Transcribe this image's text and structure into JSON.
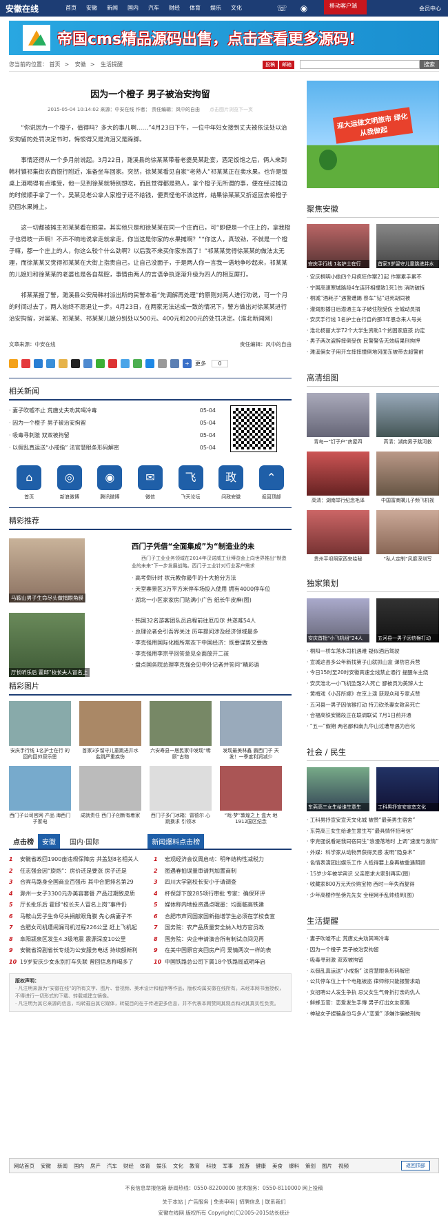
{
  "site": {
    "logo": "安徽在线",
    "member": "会员中心",
    "mobile": "移动客户端"
  },
  "nav": [
    "首页",
    "安徽",
    "新闻",
    "国内",
    "汽车",
    "财经",
    "体育",
    "娱乐",
    "文化"
  ],
  "banner": {
    "text": "帝国cms精品源码出售，点击查看更多源码!"
  },
  "breadcrumb": {
    "prefix": "您当前的位置：",
    "items": [
      "首页",
      "安徽",
      "生活提醒"
    ]
  },
  "tools": {
    "tag1": "投稿",
    "tag2": "邮箱",
    "search_btn": "搜索"
  },
  "article": {
    "title": "因为一个橙子 男子被治安拘留",
    "meta": "2015-05-04 10:14:02 来源：中安在线 作者：  责任编辑：风中的自由",
    "meta_gray": "点击图片浏览下一页",
    "paragraphs": [
      "“你说因为一个橙子，值得吗？多大的事儿啊……”4月23日下午，一位中年妇女接到丈夫被依法处以治安拘留的处罚决定书时，悔恨得又是流泪又是跺脚。",
      "事情还得从一个多月前说起。3月22日，濉溪县的徐某某带着老婆吴某赴宴，酒足饭饱之后，俩人来到韩村镇祁集街农商银行附近，准备坐车回家。突然，徐某某看见自家“老熟人”祁某某正在卖水果。也许是饭桌上酒喝得有点难受，他一见到徐某就特别想吃，而且觉得都是熟人，拿个橙子无所谓的事，便在经过摊边的时候顺手拿了一个。吴某见老公拿人家橙子还不给钱，便责怪他不该这样，结果徐某某又折返回去将橙子扔回水果摊上。",
      "这一切都被摊主祁某某看在眼里。其实他只是和徐某某在同一个庄而已，可“即便是一个庄上的，拿我橙子也得吱一声啊！不声不响地说拿走就拿走，你当这是你家的水果摊啊？”“你这人，真较劲，不就是一个橙子嘛，都一个庄上的人，你这么较个什么劲啊？以后我不来买你家东西了！”祁某某觉得徐某某的做法太无理，而徐某某又觉得祁某某在大街上指责自己，让自己没面子，于是两人你一言我一语地争吵起来，祁某某的儿媳妇和徐某某的老婆也是各自帮腔，事情由两人的言语争执逐渐升级为四人的相互厮打。",
      "祁某某报了警，濉溪县公安局韩村派出所的民警本着“先调解再处理”的原则对两人进行劝说，可一个月的时间过去了，两人始终不愿退让一步。4月23日，在两家无法达成一致的情况下，警方做出对徐某某进行治安拘留，对吴某、祁某某、祁某某儿媳分别处以500元、400元和200元的处罚决定。(淮北新闻网)"
    ],
    "source_label": "文章来源：中安在线",
    "editor_label": "责任编辑：风中的自由",
    "share_more": "更多",
    "share_count": "0"
  },
  "related": {
    "title": "相关新闻",
    "items": [
      {
        "t": "妻子吹嘘不止 荒唐丈夫劝其喝冷毒",
        "d": "05-04"
      },
      {
        "t": "因为一个橙子 男子被治安拘留",
        "d": "05-04"
      },
      {
        "t": "吸毒寻刺激 双双被拘留",
        "d": "05-04"
      },
      {
        "t": "以假乱真运送“小戒指” 法官慧眼条形码解密",
        "d": "05-04"
      }
    ]
  },
  "apps": [
    "首页",
    "新浪微博",
    "腾讯微博",
    "微信",
    "飞天论坛",
    "问政安徽",
    "返回顶部"
  ],
  "picks": {
    "title": "精彩推荐",
    "cap1": "马鞍山男子生命尽头做捐眼角膜",
    "cap2": "厅长听乐后 霍邱“校长夫人冒名上",
    "head": "西门子凭借“全面集成”为“制造业的未",
    "sub": "西门子工业业务领域在2014年汉诺威工业博览会上向世界推出“制造业的未来”下一步发展战略。西门子工业针对行业客户需求",
    "list1": [
      "高考倒计时 状元教你最牛的十大抢分方法",
      "天堂寨景区3万平方米停车场投入使用 拥有4000停车位",
      "湖北一小区家家房门贴满小广告 纸长牛皮癣(图)"
    ],
    "list2": [
      "韩国32名游客团队员启程前往厄瓜尔 共遂难54人",
      "总理论者会引吾界关注 历年提问涉及经济领域最多",
      "李克强用国际化概所常态下中国经济：既要谋势又要做",
      "李克强用李宗平回答意见全面放开二孩",
      "盘点国务院总理李克强会见中外记者并答问“精彩语"
    ]
  },
  "gallery": {
    "title": "精彩图片",
    "items": [
      "安庆手行线 1名护士在行 的回的回帅原乐思",
      "首家3岁留守儿童跳进井水 盐跳严重疾伤",
      "六安寿县一居民家中发现“稀顾”古物",
      "发现最美林鑫 霸西门子 天发！一季度利润减少",
      "西门子公司官网 产品 海西门子家电",
      "成就责任 西门子创新有着家",
      "西门子多门冰箱：雷德尔 心跳换求 引领冰",
      "“戏·梦”敦煌之上 盒大 地1912国区纪念"
    ]
  },
  "rank": {
    "tab_title": "点击榜",
    "tab1": "安徽",
    "tab2": "国内·国际",
    "tab3": "新闻爆料点击榜",
    "left": [
      "安徽省政回1900亩违规保障房 共盖划8名相关人",
      "任志强会因“旋炮”：房价还是要涨 房子还是",
      "合宾马路身全国商业百强市 其中合肥排名第29",
      "滁州一女子3300元办美容套餐 产品过期致皮质",
      "厅长批乐后 霍邱“校长夫人冒名上岗”事件仍",
      "马鞍山男子生命尽头捐献眼角膜 先心病妻子不",
      "合肥女司机遭闹漏司机过程226公里 赶上飞机起",
      "阜阳颍泉区发生4.3级地震 震源深度10公里",
      "安徽省滑副省长专线为公安服务电话 持续额新利",
      "19岁安庆少女永别打车失联 曾回信息称喝多了"
    ],
    "right": [
      "宏观经济会议周启动：明年结构性减税力",
      "图遇春拍误量审请判加置商制",
      "四川大学副校长安小于请调查",
      "杯保部下放285项行审批 专家：确保环评",
      "媒体称内地投资遇点哦墨：均面临高铁建",
      "合肥市声同国家国新指增学生必须在学校食宣",
      "国务院：农产品质量安全纳入地方官员政",
      "国务院：央企申请演合所有制试点间见再",
      "在美中国原官夹回房产问 爱情两次一样的表",
      "中国铁路总公司下属18个铁路局或明年启"
    ]
  },
  "disclaimer": {
    "h": "版权声明：",
    "lines": [
      "· 凡注明来源为“安徽在线”的所有文字、图片、音视频、美术设计和程序等作品，版权均属安徽在线所有。未经本网书面授权，不得进行一切形式的下载、转载或建立镜像。",
      "· 凡注明为其它来源的信息，均转载自其它媒体，转载目的在于传递更多信息，并不代表本网赞同其观点和对其真实性负责。"
    ]
  },
  "side": {
    "ad_text": "迎大运做文明旅市 绿化从我做起",
    "s1": {
      "title": "聚焦安徽",
      "pic1": "安庆手行线 1名护士在行",
      "pic2": "首家3岁留守儿童跳进井水",
      "list": [
        "安庆桐明小偷四个月疯狂作案21起 作案累手累不",
        "宁国高速寒城路段4车连环相撞致1死1伤 消防破拆",
        "桐城“酒耗子”遇警遭踢 祭车“钻”进死胡同被",
        "灌溉影播日后潜通主车子破住院受伤 全城动员捐",
        "安庆手行线 1名护士在行自的那3年恩念来人号关",
        "淮北杨丽大学72个大学生资助1个贫困家庭孩 约定",
        "男子两次盗醉摔倒受伤 民警警告无效结果刑拘押",
        "濉溪俩女子用开车摔摔撞倒地冈面东被带去超警前"
      ]
    },
    "s2": {
      "title": "高清组图",
      "pics": [
        "青岛一“钉子户”房屋四",
        "高清：湖南男子跳河救",
        "高清：湖南举行纪念毛泽",
        "中国富商購儿子频飞机视",
        "贵州平坝照家西安绘秘",
        "“私人定制”风靡深圳写"
      ]
    },
    "s3": {
      "title": "独家策划",
      "pic1": "安庆首批“小飞机组”24人",
      "pic2": "五河县一男子因信猴打动",
      "list": [
        "桐阳一桥车落水司机遇难 疑似酒后驾驶",
        "宣城这县多公年新找第子山就抓山盒 涕防官兵营",
        "今日15时至20时安徽高速全线禁止通行 提醒车主绕",
        "安庆淮北一小飞机坠毁2人死亡 鄙被员为美辨人士",
        "黄梅戏《小苏所嫁》在京上演 获观众和专家点赞",
        "五河县一男子因信猴打动 持刀砍杀妻女致亲死亡",
        "合福高铁安徽段正在联调联试 7月1日前开通",
        "“五一”假期 两名鄙和南九华山过遭导遇为自化"
      ]
    },
    "s4": {
      "title": "社会 / 民生",
      "pic1": "东莞高三女生给谁生意生",
      "pic2": "工科男抒宣安宣恋文化",
      "list": [
        "工科男抒宣安宣天文化城 被赞“最美男生宿舍”",
        "东莞高三女生给谁生意生写“最具情怀招考信”",
        "李克强说看是我同宿同生“浪漫落地时 上调“速度与激情”",
        "外媒：科学家从动物界获得灵感 发明“隐身术”",
        "色情表演团出娱乐工作 人抵得要上身再被重遇照顾",
        "15岁少年被学宾识 父亲愿求大家别再实(图)",
        "收藏家800万元天价购宝物 西时一年失而复得",
        "少年高楼作坠傍先先女 全程网手乱帅线到(图)"
      ]
    },
    "s5": {
      "title": "生活提醒",
      "list": [
        "妻子吹嘘不止 荒唐丈夫劝其喝冷毒",
        "因为一个橙子 男子被治安拘留",
        "吸毒寻刺激 双双被拘留",
        "以假乱真运送“小戒指” 法官慧眼条形码解密",
        "公共停车位上十个电瓶被盗 律师称只能报警求助",
        "女招聘公人发生争执 忌父女生气骨折打亲的仇人",
        "鲜蜂五官：恋爱发生手傳 男子打出女友家路",
        "神秘女子捏骗身份与多人“恋爱” 涉嫌诈骗被刑拘"
      ]
    }
  },
  "footer": {
    "nav": [
      "网站首页",
      "安徽",
      "新闻",
      "国内",
      "房产",
      "汽车",
      "财经",
      "体育",
      "娱乐",
      "文化",
      "教育",
      "科技",
      "军事",
      "旅游",
      "健康",
      "美食",
      "爆料",
      "策划",
      "图片",
      "视频"
    ],
    "backtop": "返回顶部",
    "line1": "不良信息举报信箱 新闻热线：0550-82200000 技术服务：0550-8110000 网上投稿",
    "line2": "关于本站 | 广告服务 | 免责申明 | 招聘信息 | 联系我们",
    "line3": "安徽在线网 版权所有 Copyright(C)2005-2015站长统计"
  },
  "colors": {
    "navy": "#1d3d74",
    "red": "#c8161d",
    "blue": "#1f5fa8"
  }
}
